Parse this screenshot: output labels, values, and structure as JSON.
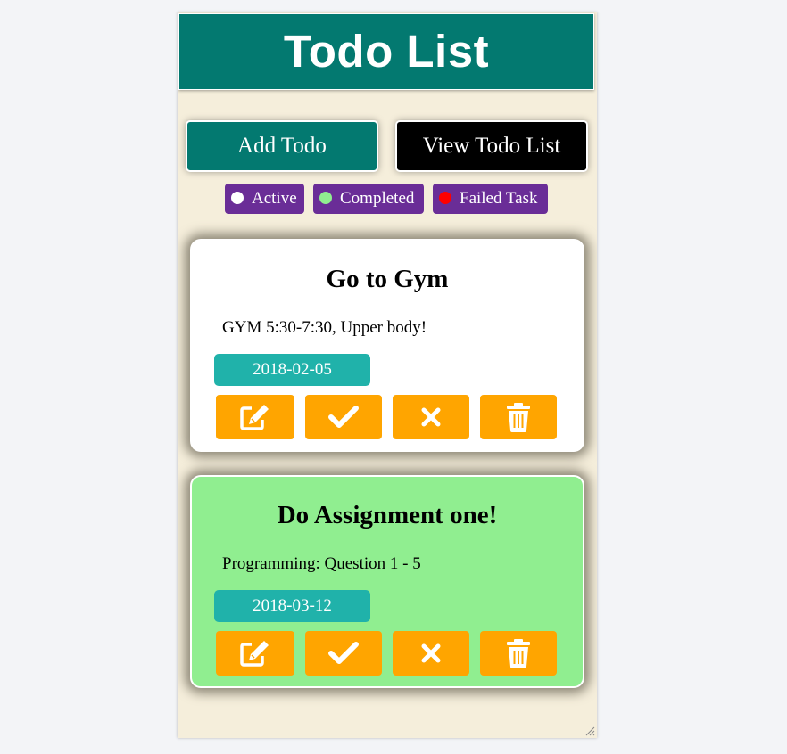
{
  "app": {
    "title": "Todo List"
  },
  "toolbar": {
    "add_label": "Add Todo",
    "view_label": "View Todo List"
  },
  "legend": [
    {
      "label": "Active",
      "color": "#ffffff"
    },
    {
      "label": "Completed",
      "color": "#90ee90"
    },
    {
      "label": "Failed Task",
      "color": "#ff0000"
    }
  ],
  "todos": [
    {
      "title": "Go to Gym",
      "description": "GYM 5:30-7:30, Upper body!",
      "date": "2018-02-05",
      "status": "active",
      "background": "#ffffff"
    },
    {
      "title": "Do Assignment one!",
      "description": "Programming: Question 1 - 5",
      "date": "2018-03-12",
      "status": "completed",
      "background": "#90ee90"
    }
  ],
  "actions": {
    "icons": [
      "edit-icon",
      "check-icon",
      "x-icon",
      "trash-icon"
    ],
    "color": "#ffa500"
  },
  "colors": {
    "header": "#037970",
    "legend_chip": "#6a2d97",
    "date_badge": "#20b2aa",
    "page_background": "#f5eedb"
  }
}
